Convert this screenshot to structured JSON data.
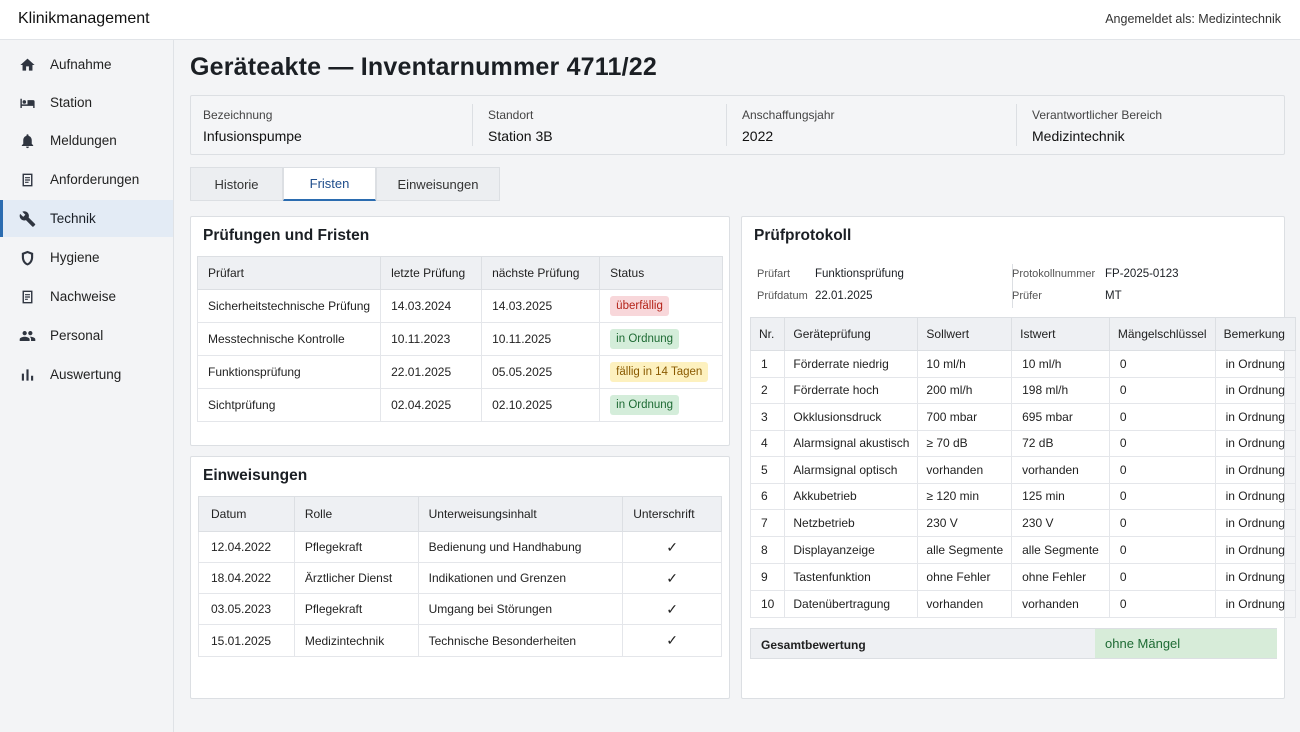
{
  "app": {
    "title": "Klinikmanagement",
    "user": "Angemeldet als: Medizintechnik"
  },
  "sidebar": {
    "items": [
      {
        "label": "Aufnahme",
        "icon": "home-icon"
      },
      {
        "label": "Station",
        "icon": "bed-icon"
      },
      {
        "label": "Meldungen",
        "icon": "bell-icon"
      },
      {
        "label": "Anforderungen",
        "icon": "document-icon"
      },
      {
        "label": "Technik",
        "icon": "wrench-icon",
        "active": true
      },
      {
        "label": "Hygiene",
        "icon": "shield-icon"
      },
      {
        "label": "Nachweise",
        "icon": "document-check-icon"
      },
      {
        "label": "Personal",
        "icon": "people-icon"
      },
      {
        "label": "Auswertung",
        "icon": "bar-chart-icon"
      }
    ]
  },
  "page": {
    "title": "Geräteakte — Inventarnummer 4711/22"
  },
  "info": [
    {
      "label": "Bezeichnung",
      "value": "Infusionspumpe"
    },
    {
      "label": "Standort",
      "value": "Station 3B"
    },
    {
      "label": "Anschaffungsjahr",
      "value": "2022"
    },
    {
      "label": "Verantwortlicher Bereich",
      "value": "Medizintechnik"
    }
  ],
  "tabs": [
    {
      "label": "Historie"
    },
    {
      "label": "Fristen",
      "active": true
    },
    {
      "label": "Einweisungen"
    }
  ],
  "pruefungen": {
    "title": "Prüfungen und Fristen",
    "headers": [
      "Prüfart",
      "letzte Prüfung",
      "nächste Prüfung",
      "Status"
    ],
    "rows": [
      {
        "art": "Sicherheitstechnische Prüfung",
        "letzte": "14.03.2024",
        "naechste": "14.03.2025",
        "status": "überfällig",
        "status_color": "red"
      },
      {
        "art": "Messtechnische Kontrolle",
        "letzte": "10.11.2023",
        "naechste": "10.11.2025",
        "status": "in Ordnung",
        "status_color": "green"
      },
      {
        "art": "Funktionsprüfung",
        "letzte": "22.01.2025",
        "naechste": "05.05.2025",
        "status": "fällig in 14 Tagen",
        "status_color": "yellow"
      },
      {
        "art": "Sichtprüfung",
        "letzte": "02.04.2025",
        "naechste": "02.10.2025",
        "status": "in Ordnung",
        "status_color": "green"
      }
    ]
  },
  "einweisungen": {
    "title": "Einweisungen",
    "headers": [
      "Datum",
      "Rolle",
      "Unterweisungsinhalt",
      "Unterschrift"
    ],
    "rows": [
      {
        "datum": "12.04.2022",
        "rolle": "Pflegekraft",
        "inhalt": "Bedienung und Handhabung",
        "unterschrift": "✓"
      },
      {
        "datum": "18.04.2022",
        "rolle": "Ärztlicher Dienst",
        "inhalt": "Indikationen und Grenzen",
        "unterschrift": "✓"
      },
      {
        "datum": "03.05.2023",
        "rolle": "Pflegekraft",
        "inhalt": "Umgang bei Störungen",
        "unterschrift": "✓"
      },
      {
        "datum": "15.01.2025",
        "rolle": "Medizintechnik",
        "inhalt": "Technische Besonderheiten",
        "unterschrift": "✓"
      }
    ]
  },
  "protokoll": {
    "title": "Prüfprotokoll",
    "meta": {
      "pruefart_label": "Prüfart",
      "pruefart": "Funktionsprüfung",
      "pruefdatum_label": "Prüfdatum",
      "pruefdatum": "22.01.2025",
      "nummer_label": "Protokollnummer",
      "nummer": "FP-2025-0123",
      "pruefer_label": "Prüfer",
      "pruefer": "MT"
    },
    "headers": [
      "Nr.",
      "Geräteprüfung",
      "Sollwert",
      "Istwert",
      "Mängelschlüssel",
      "Bemerkung"
    ],
    "rows": [
      {
        "nr": "1",
        "pruefung": "Förderrate niedrig",
        "soll": "10 ml/h",
        "ist": "10 ml/h",
        "schluessel": "0",
        "bemerkung": "in Ordnung"
      },
      {
        "nr": "2",
        "pruefung": "Förderrate hoch",
        "soll": "200 ml/h",
        "ist": "198 ml/h",
        "schluessel": "0",
        "bemerkung": "in Ordnung"
      },
      {
        "nr": "3",
        "pruefung": "Okklusionsdruck",
        "soll": "700 mbar",
        "ist": "695 mbar",
        "schluessel": "0",
        "bemerkung": "in Ordnung"
      },
      {
        "nr": "4",
        "pruefung": "Alarmsignal akustisch",
        "soll": "≥ 70 dB",
        "ist": "72 dB",
        "schluessel": "0",
        "bemerkung": "in Ordnung"
      },
      {
        "nr": "5",
        "pruefung": "Alarmsignal optisch",
        "soll": "vorhanden",
        "ist": "vorhanden",
        "schluessel": "0",
        "bemerkung": "in Ordnung"
      },
      {
        "nr": "6",
        "pruefung": "Akkubetrieb",
        "soll": "≥ 120 min",
        "ist": "125 min",
        "schluessel": "0",
        "bemerkung": "in Ordnung"
      },
      {
        "nr": "7",
        "pruefung": "Netzbetrieb",
        "soll": "230 V",
        "ist": "230 V",
        "schluessel": "0",
        "bemerkung": "in Ordnung"
      },
      {
        "nr": "8",
        "pruefung": "Displayanzeige",
        "soll": "alle Segmente",
        "ist": "alle Segmente",
        "schluessel": "0",
        "bemerkung": "in Ordnung"
      },
      {
        "nr": "9",
        "pruefung": "Tastenfunktion",
        "soll": "ohne Fehler",
        "ist": "ohne Fehler",
        "schluessel": "0",
        "bemerkung": "in Ordnung"
      },
      {
        "nr": "10",
        "pruefung": "Datenübertragung",
        "soll": "vorhanden",
        "ist": "vorhanden",
        "schluessel": "0",
        "bemerkung": "in Ordnung"
      }
    ],
    "gesamt_label": "Gesamtbewertung",
    "gesamt_value": "ohne Mängel"
  }
}
